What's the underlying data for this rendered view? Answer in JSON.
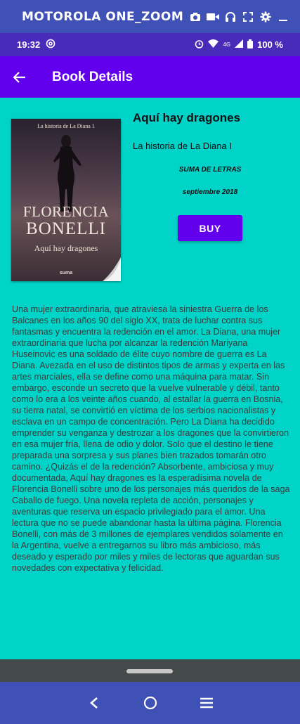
{
  "emulator": {
    "title": "MOTOROLA ONE_ZOOM",
    "icons": [
      "camera-icon",
      "video-icon",
      "headset-icon",
      "fullscreen-icon",
      "settings-icon",
      "minimize-icon"
    ]
  },
  "status_bar": {
    "time": "19:32",
    "network_label": "4G",
    "battery": "100 %"
  },
  "app_bar": {
    "title": "Book Details"
  },
  "book": {
    "title": "Aquí hay dragones",
    "series": "La historia de La Diana I",
    "publisher": "SUMA DE LETRAS",
    "date": "septiembre 2018",
    "buy_label": "BUY",
    "cover": {
      "series_text": "La historia de La Diana 1",
      "author_line1": "FLORENCIA",
      "author_line2": "BONELLI",
      "subtitle": "Aquí hay dragones",
      "publisher_mark": "suma"
    },
    "description": "Una mujer extraordinaria, que atraviesa la siniestra Guerra de los Balcanes en los años 90 del siglo XX, trata de luchar contra sus fantasmas y encuentra la redención en el amor. La Diana, una mujer extraordinaria que lucha por alcanzar la redención Mariyana Huseinovic es una soldado de élite cuyo nombre de guerra es La Diana. Avezada en el uso de distintos tipos de armas y experta en las artes marciales, ella se define como una máquina para matar. Sin embargo, esconde un secreto que la vuelve vulnerable y débil, tanto como lo era a los veinte años cuando, al estallar la guerra en Bosnia, su tierra natal, se convirtió en víctima de los serbios nacionalistas y esclava en un campo de concentración. Pero La Diana ha decidido emprender su venganza y destrozar a los dragones que la convirtieron en esa mujer fría, llena de odio y dolor. Solo que el destino le tiene preparada una sorpresa y sus planes bien trazados tomarán otro camino. ¿Quizás el de la redención? Absorbente, ambiciosa y muy documentada, Aquí hay dragones es la esperadísima novela de Florencia Bonelli sobre uno de los personajes más queridos de la saga Caballo de fuego. Una novela repleta de acción, personajes y aventuras que reserva un espacio privilegiado para el amor. Una lectura que no se puede abandonar hasta la última página. Florencia Bonelli, con más de 3 millones de ejemplares vendidos solamente en la Argentina, vuelve a entregarnos su libro más ambicioso, más deseado y esperado por miles y miles de lectoras que aguardan sus novedades con expectativa y felicidad."
  },
  "colors": {
    "background": "#00d4c8",
    "app_bar": "#6200ee",
    "emulator_bar": "#3f51b5",
    "buy_button": "#6200ee"
  }
}
